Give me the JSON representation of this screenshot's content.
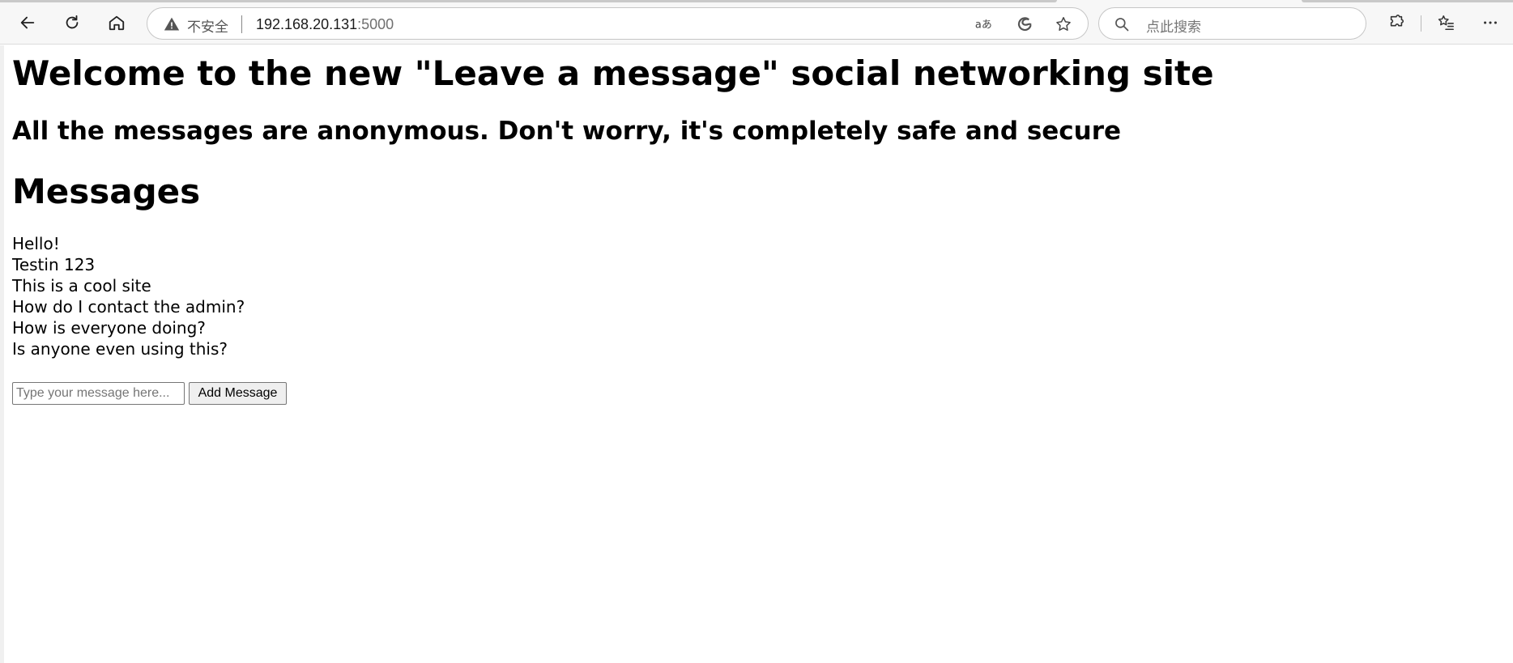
{
  "browser": {
    "security_label": "不安全",
    "url_host": "192.168.20.131",
    "url_port": ":5000",
    "search_placeholder": "点此搜索",
    "icons": {
      "back": "back-arrow-icon",
      "refresh": "refresh-icon",
      "home": "home-icon",
      "insecure": "warning-triangle-icon",
      "read_aloud": "read-aloud-icon",
      "edge": "edge-logo-icon",
      "favorite": "star-icon",
      "search": "search-icon",
      "extensions": "puzzle-icon",
      "favorites": "favorites-list-icon",
      "more": "more-dots-icon"
    }
  },
  "page": {
    "title": "Welcome to the new \"Leave a message\" social networking site",
    "subtitle": "All the messages are anonymous. Don't worry, it's completely safe and secure",
    "messages_heading": "Messages",
    "messages": [
      "Hello!",
      "Testin 123",
      "This is a cool site",
      "How do I contact the admin?",
      "How is everyone doing?",
      "Is anyone even using this?"
    ],
    "form": {
      "input_placeholder": "Type your message here...",
      "input_value": "",
      "submit_label": "Add Message"
    }
  }
}
